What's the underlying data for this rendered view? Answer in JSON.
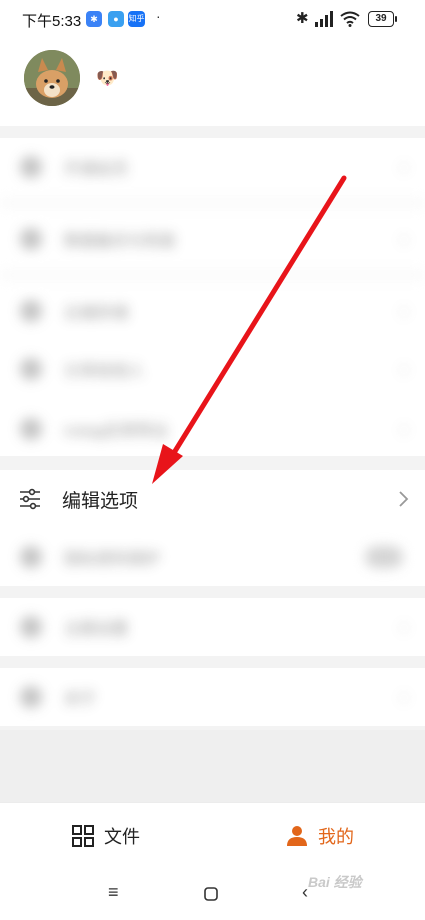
{
  "status_bar": {
    "time": "下午5:33",
    "notif_badge_zhihu": "知乎",
    "dot": "·",
    "bluetooth_glyph": "✱",
    "battery": "39"
  },
  "profile": {
    "username_emoji": "🐶"
  },
  "blurred_menu_items": [
    {
      "icon": "vip-icon",
      "label": "开通会员"
    },
    {
      "icon": "phone-icon",
      "label": "数据备份与恢复"
    },
    {
      "icon": "cloud-icon",
      "label": "云端存储"
    },
    {
      "icon": "link-icon",
      "label": "分享给他人"
    },
    {
      "icon": "file-icon",
      "label": "notag应用导出"
    }
  ],
  "edit_options": {
    "label": "编辑选项",
    "icon": "sliders-icon"
  },
  "blurred_lower_items": [
    {
      "icon": "lock-icon",
      "label": "隐私密码保护"
    },
    {
      "icon": "settings-icon",
      "label": "主题设置"
    },
    {
      "icon": "info-icon",
      "label": "关于"
    }
  ],
  "tabs": {
    "files": "文件",
    "mine": "我的"
  },
  "watermark": "Bai 经验",
  "colors": {
    "accent": "#e2661a",
    "annotation": "#e8141a"
  }
}
